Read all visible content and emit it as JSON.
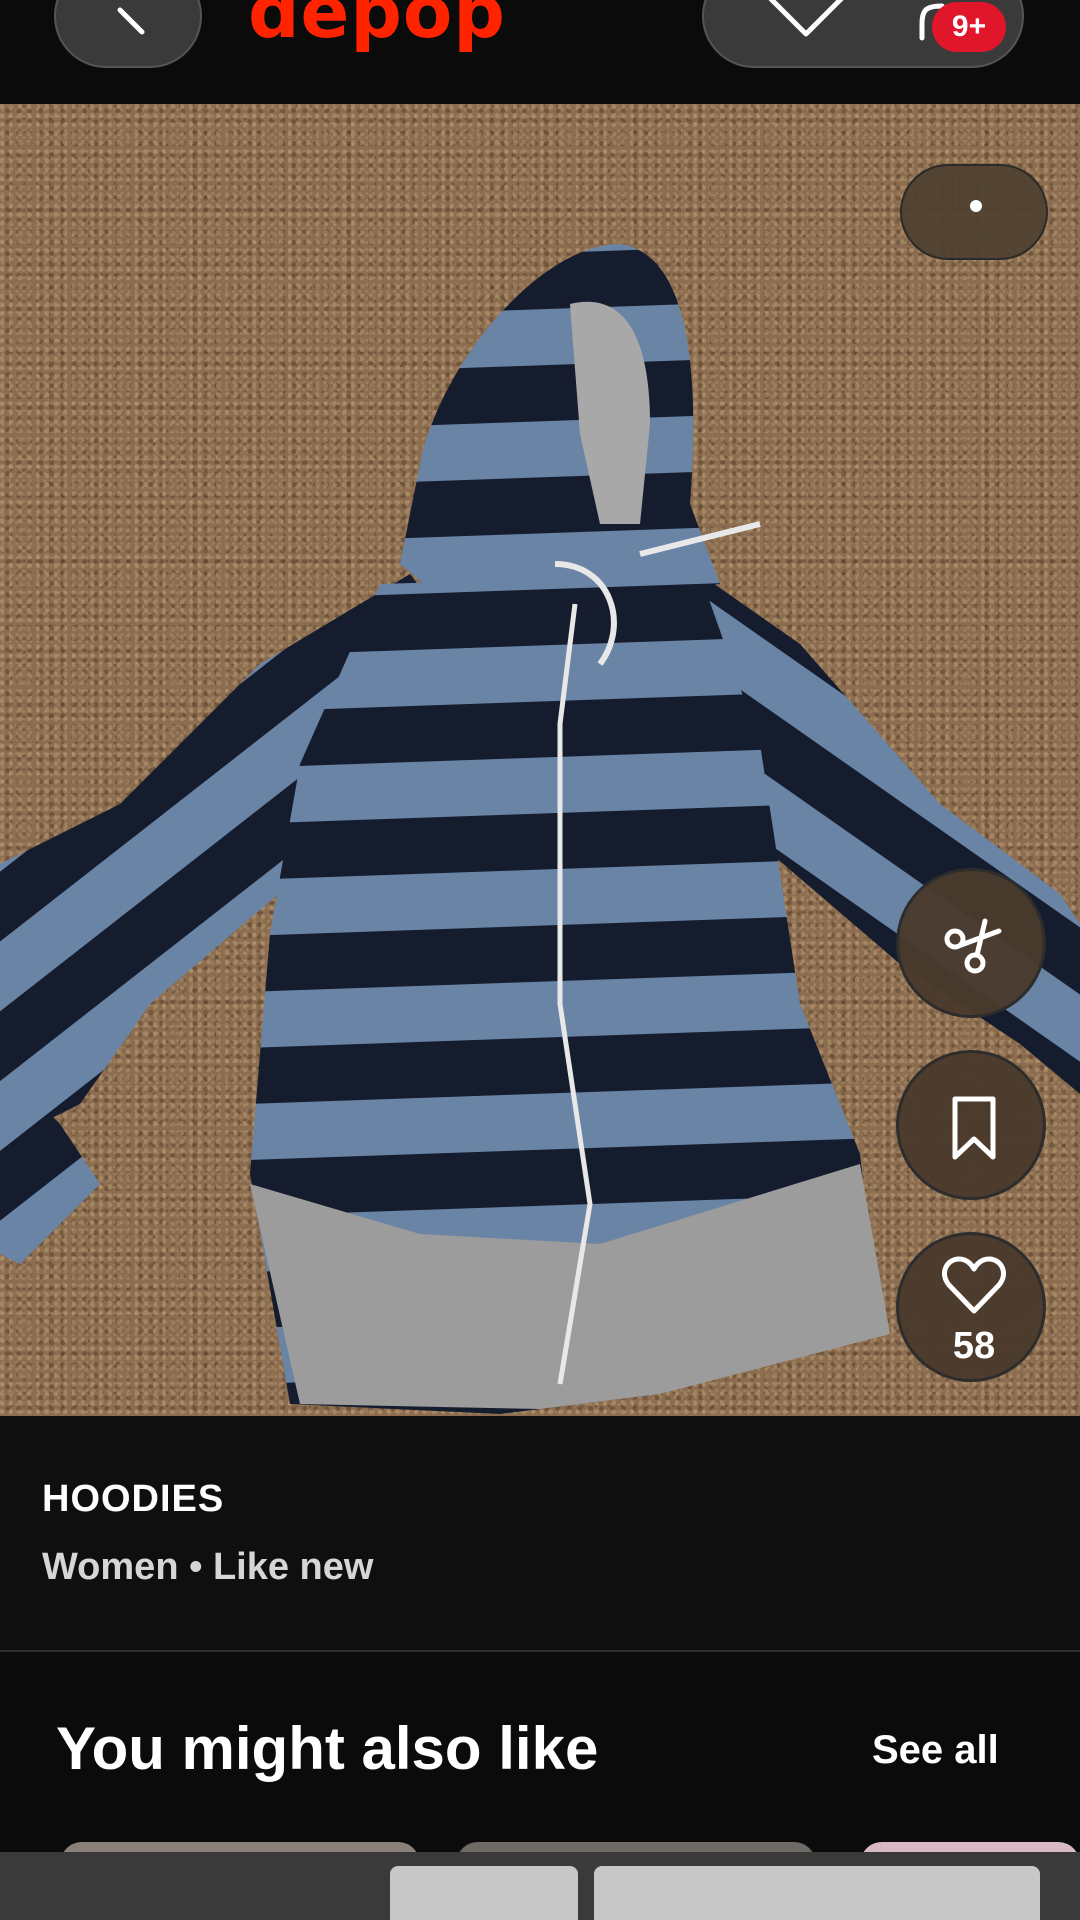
{
  "app": {
    "logo_text": "depop",
    "brand_color": "#ff2300"
  },
  "header": {
    "cart_badge": "9+"
  },
  "product": {
    "like_count": "58",
    "category": "HOODIES",
    "meta": "Women • Like new"
  },
  "suggestions": {
    "title": "You might also like",
    "see_all": "See all"
  },
  "icons": {
    "back": "chevron-left-icon",
    "favorite": "heart-icon",
    "bag": "shopping-bag-icon",
    "more": "more-dots-icon",
    "share": "scissors-icon",
    "save": "bookmark-icon",
    "like": "heart-icon"
  }
}
